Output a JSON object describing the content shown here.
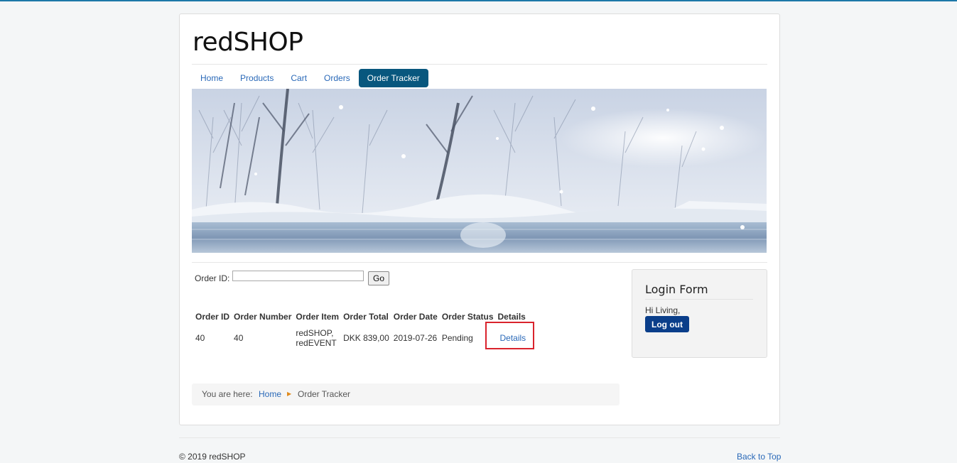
{
  "site": {
    "brand": "redSHOP"
  },
  "nav": {
    "items": [
      {
        "label": "Home"
      },
      {
        "label": "Products"
      },
      {
        "label": "Cart"
      },
      {
        "label": "Orders"
      },
      {
        "label": "Order Tracker",
        "active": true
      }
    ]
  },
  "tracker": {
    "order_id_label": "Order ID:",
    "order_id_value": "",
    "go_label": "Go"
  },
  "orders_table": {
    "headers": [
      "Order ID",
      "Order Number",
      "Order Item",
      "Order Total",
      "Order Date",
      "Order Status",
      "Details"
    ],
    "rows": [
      {
        "order_id": "40",
        "order_number": "40",
        "order_item_line1": "redSHOP,",
        "order_item_line2": "redEVENT",
        "order_total": "DKK 839,00",
        "order_date": "2019-07-26",
        "order_status": "Pending",
        "details_link": "Details"
      }
    ]
  },
  "breadcrumb": {
    "prefix": "You are here:",
    "home": "Home",
    "current": "Order Tracker"
  },
  "login_form": {
    "title": "Login Form",
    "greeting": "Hi Living,",
    "logout_label": "Log out"
  },
  "footer": {
    "copyright": "© 2019 redSHOP",
    "back_to_top": "Back to Top"
  },
  "colors": {
    "accent": "#08577e",
    "link": "#2a69b8",
    "logout_button": "#0a3e8a",
    "highlight_border": "#d9232d"
  }
}
